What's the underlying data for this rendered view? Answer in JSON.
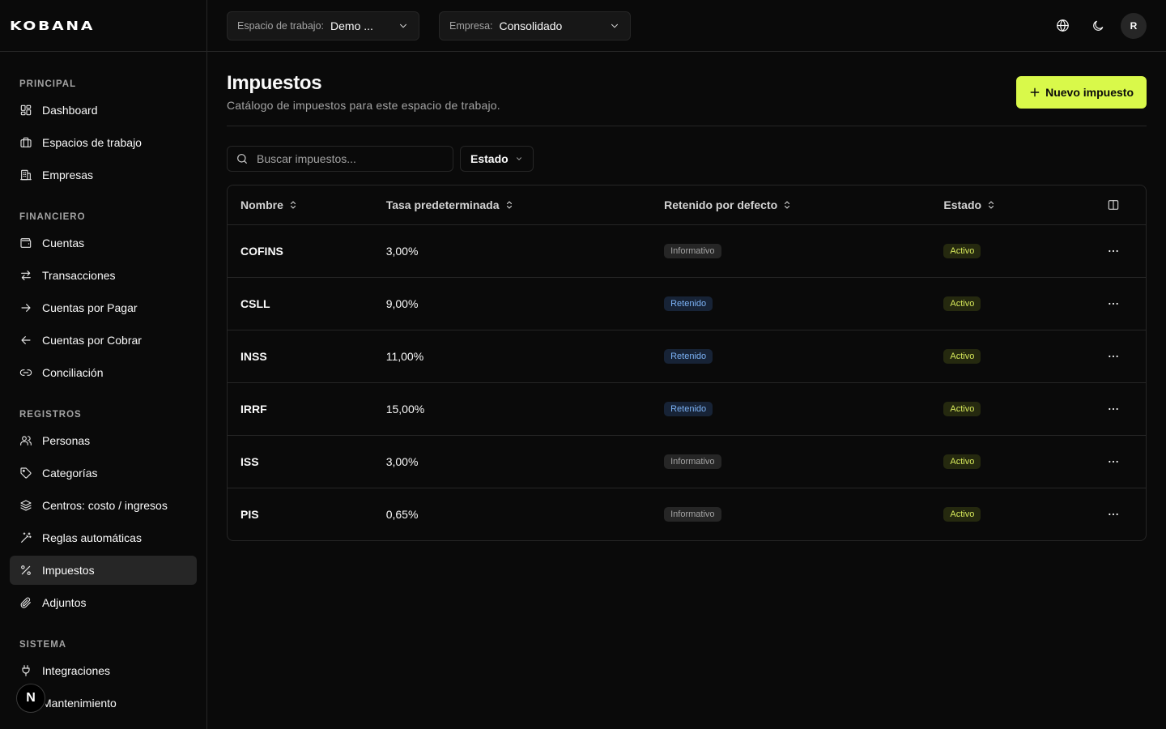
{
  "brand": {
    "name": "KOBANA"
  },
  "sidebar": {
    "sections": [
      {
        "title": "PRINCIPAL",
        "items": [
          {
            "label": "Dashboard",
            "icon": "dashboard-icon"
          },
          {
            "label": "Espacios de trabajo",
            "icon": "briefcase-icon"
          },
          {
            "label": "Empresas",
            "icon": "building-icon"
          }
        ]
      },
      {
        "title": "FINANCIERO",
        "items": [
          {
            "label": "Cuentas",
            "icon": "wallet-icon"
          },
          {
            "label": "Transacciones",
            "icon": "arrows-swap-icon"
          },
          {
            "label": "Cuentas por Pagar",
            "icon": "arrow-right-icon"
          },
          {
            "label": "Cuentas por Cobrar",
            "icon": "arrow-left-icon"
          },
          {
            "label": "Conciliación",
            "icon": "link-icon"
          }
        ]
      },
      {
        "title": "REGISTROS",
        "items": [
          {
            "label": "Personas",
            "icon": "users-icon"
          },
          {
            "label": "Categorías",
            "icon": "tag-icon"
          },
          {
            "label": "Centros: costo / ingresos",
            "icon": "layers-icon"
          },
          {
            "label": "Reglas automáticas",
            "icon": "wand-icon"
          },
          {
            "label": "Impuestos",
            "icon": "percent-icon",
            "active": true
          },
          {
            "label": "Adjuntos",
            "icon": "paperclip-icon"
          }
        ]
      },
      {
        "title": "SISTEMA",
        "items": [
          {
            "label": "Integraciones",
            "icon": "plug-icon"
          },
          {
            "label": "Mantenimiento",
            "icon": "wrench-icon"
          }
        ]
      }
    ],
    "badge": "N"
  },
  "topbar": {
    "workspace": {
      "label": "Espacio de trabajo:",
      "value": "Demo ..."
    },
    "company": {
      "label": "Empresa:",
      "value": "Consolidado"
    },
    "avatar": "R"
  },
  "page": {
    "title": "Impuestos",
    "subtitle": "Catálogo de impuestos para este espacio de trabajo.",
    "new_button": "Nuevo impuesto"
  },
  "filters": {
    "search_placeholder": "Buscar impuestos...",
    "status_filter": "Estado"
  },
  "table": {
    "columns": [
      "Nombre",
      "Tasa predeterminada",
      "Retenido por defecto",
      "Estado"
    ],
    "rows": [
      {
        "name": "COFINS",
        "rate": "3,00%",
        "withheld": "Informativo",
        "withheld_type": "info",
        "status": "Activo"
      },
      {
        "name": "CSLL",
        "rate": "9,00%",
        "withheld": "Retenido",
        "withheld_type": "held",
        "status": "Activo"
      },
      {
        "name": "INSS",
        "rate": "11,00%",
        "withheld": "Retenido",
        "withheld_type": "held",
        "status": "Activo"
      },
      {
        "name": "IRRF",
        "rate": "15,00%",
        "withheld": "Retenido",
        "withheld_type": "held",
        "status": "Activo"
      },
      {
        "name": "ISS",
        "rate": "3,00%",
        "withheld": "Informativo",
        "withheld_type": "info",
        "status": "Activo"
      },
      {
        "name": "PIS",
        "rate": "0,65%",
        "withheld": "Informativo",
        "withheld_type": "info",
        "status": "Activo"
      }
    ]
  },
  "colors": {
    "accent": "#d9f94a",
    "background": "#0a0a0a",
    "border": "#262626",
    "badge_held_text": "#7cb2f5",
    "badge_active_text": "#d6e85a"
  }
}
